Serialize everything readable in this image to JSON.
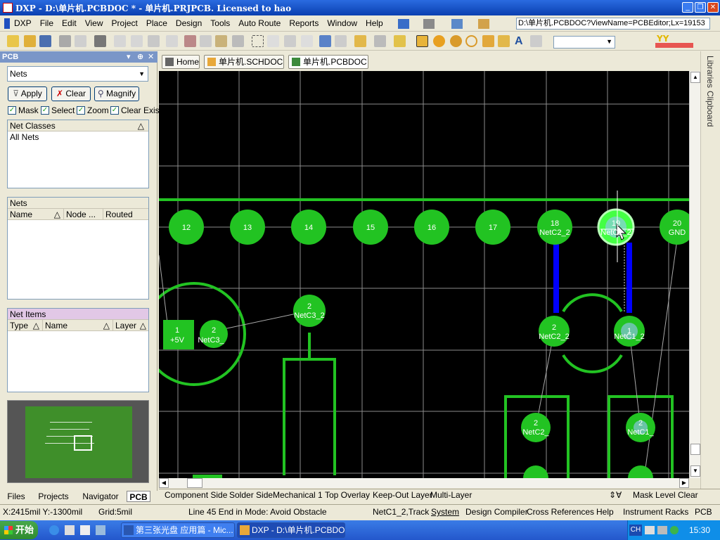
{
  "window": {
    "title": "DXP - D:\\单片机.PCBDOC * - 单片机.PRJPCB. Licensed to hao"
  },
  "menu": [
    "DXP",
    "File",
    "Edit",
    "View",
    "Project",
    "Place",
    "Design",
    "Tools",
    "Auto Route",
    "Reports",
    "Window",
    "Help"
  ],
  "address": "D:\\单片机.PCBDOC?ViewName=PCBEditor;Lx=19153",
  "panel": {
    "title": "PCB",
    "mode": "Nets",
    "buttons": [
      "Apply",
      "Clear",
      "Magnify"
    ],
    "checks": [
      "Mask",
      "Select",
      "Zoom",
      "Clear Exist"
    ],
    "net_classes": {
      "header": "Net Classes",
      "items": [
        "All Nets"
      ]
    },
    "nets": {
      "header": "Nets",
      "cols": [
        "Name",
        "Node ...",
        "Routed"
      ]
    },
    "net_items": {
      "header": "Net Items",
      "cols": [
        "Type",
        "Name",
        "Layer"
      ]
    },
    "bottom_tabs": [
      "Files",
      "Projects",
      "Navigator",
      "PCB"
    ]
  },
  "doc_tabs": [
    "Home",
    "单片机.SCHDOC *",
    "单片机.PCBDOC *"
  ],
  "right_tabs": [
    "Libraries",
    "Clipboard"
  ],
  "pads": [
    {
      "num": "12",
      "net": ""
    },
    {
      "num": "13",
      "net": ""
    },
    {
      "num": "14",
      "net": ""
    },
    {
      "num": "15",
      "net": ""
    },
    {
      "num": "16",
      "net": ""
    },
    {
      "num": "17",
      "net": ""
    },
    {
      "num": "18",
      "net": "NetC2_2"
    },
    {
      "num": "19",
      "net": "NetC1_2"
    },
    {
      "num": "20",
      "net": "GND"
    }
  ],
  "parts": {
    "p1": {
      "num": "1",
      "net": "+5V"
    },
    "p2": {
      "num": "2",
      "net": "NetC3_"
    },
    "p3": {
      "num": "2",
      "net": "NetC3_2"
    },
    "p4": {
      "num": "2",
      "net": "NetC2_2"
    },
    "p5": {
      "num": "1",
      "net": "NetC1_2"
    },
    "p6": {
      "num": "2",
      "net": "NetC2_"
    },
    "p7": {
      "num": "2",
      "net": "NetC1_"
    }
  },
  "layers": [
    "Component Side",
    "Solder Side",
    "Mechanical 1",
    "Top Overlay",
    "Keep-Out Layer",
    "Multi-Layer"
  ],
  "layer_right": [
    "Mask Level",
    "Clear"
  ],
  "status": {
    "coords": "X:2415mil Y:-1300mil",
    "grid": "Grid:5mil",
    "message": "Line 45 End  in Mode: Avoid Obstacle",
    "object": "NetC1_2,Track",
    "buttons": [
      "System",
      "Design Compiler",
      "Cross References",
      "Help",
      "Instrument Racks",
      "PCB"
    ]
  },
  "taskbar": {
    "start": "开始",
    "tasks": [
      "第三张光盘 应用篇 - Mic...",
      "DXP - D:\\单片机.PCBDO..."
    ],
    "tray_ime": "CH",
    "clock": "15:30"
  },
  "colors": {
    "pad": "#22c322",
    "pad_ring": "#33ee33",
    "track": "#0000ff",
    "overlay": "#22c322",
    "grid": "#8c8c8c"
  }
}
